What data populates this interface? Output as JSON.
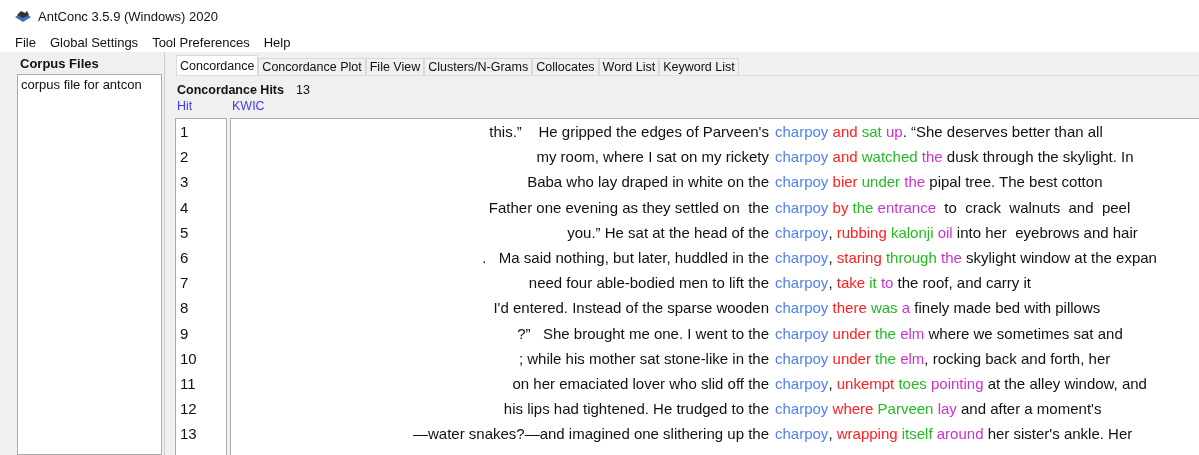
{
  "window": {
    "title": "AntConc 3.5.9 (Windows) 2020"
  },
  "menu": [
    "File",
    "Global Settings",
    "Tool Preferences",
    "Help"
  ],
  "corpus_files": {
    "heading": "Corpus Files",
    "files": [
      "corpus file for antcon"
    ]
  },
  "tabs": [
    {
      "label": "Concordance",
      "selected": true
    },
    {
      "label": "Concordance Plot",
      "selected": false
    },
    {
      "label": "File View",
      "selected": false
    },
    {
      "label": "Clusters/N-Grams",
      "selected": false
    },
    {
      "label": "Collocates",
      "selected": false
    },
    {
      "label": "Word List",
      "selected": false
    },
    {
      "label": "Keyword List",
      "selected": false
    }
  ],
  "concordance": {
    "hits_label": "Concordance Hits",
    "hits_count": "13",
    "columns": [
      "Hit",
      "KWIC"
    ],
    "rows": [
      {
        "hit": "1",
        "left": "this.”    He gripped the edges of Parveen's",
        "keyword": "charpoy",
        "words": [
          {
            "text": "and",
            "color": "#ff2020"
          },
          {
            "text": "sat",
            "color": "#22bb22"
          },
          {
            "text": "up",
            "color": "#cc33cc"
          }
        ],
        "trail": ". “She deserves better than all"
      },
      {
        "hit": "2",
        "left": "my room, where I sat on my rickety",
        "keyword": "charpoy",
        "words": [
          {
            "text": "and",
            "color": "#ff2020"
          },
          {
            "text": "watched",
            "color": "#22bb22"
          },
          {
            "text": "the",
            "color": "#cc33cc"
          }
        ],
        "trail": " dusk through the skylight. In"
      },
      {
        "hit": "3",
        "left": "Baba who lay draped in white on the",
        "keyword": "charpoy",
        "words": [
          {
            "text": "bier",
            "color": "#ff2020"
          },
          {
            "text": "under",
            "color": "#22bb22"
          },
          {
            "text": "the",
            "color": "#cc33cc"
          }
        ],
        "trail": " pipal tree. The best cotton"
      },
      {
        "hit": "4",
        "left": "Father one evening as they settled on  the",
        "keyword": "charpoy",
        "words": [
          {
            "text": "by",
            "color": "#ff2020"
          },
          {
            "text": "the",
            "color": "#22bb22"
          },
          {
            "text": "entrance",
            "color": "#cc33cc"
          }
        ],
        "trail": "  to  crack  walnuts  and  peel"
      },
      {
        "hit": "5",
        "left": "you.” He sat at the head of the",
        "keyword": "charpoy",
        "lead": ",",
        "words": [
          {
            "text": "rubbing",
            "color": "#ff2020"
          },
          {
            "text": "kalonji",
            "color": "#22bb22"
          },
          {
            "text": "oil",
            "color": "#cc33cc"
          }
        ],
        "trail": " into her  eyebrows and hair"
      },
      {
        "hit": "6",
        "left": ".   Ma said nothing, but later, huddled in the",
        "keyword": "charpoy",
        "lead": ",",
        "words": [
          {
            "text": "staring",
            "color": "#ff2020"
          },
          {
            "text": "through",
            "color": "#22bb22"
          },
          {
            "text": "the",
            "color": "#cc33cc"
          }
        ],
        "trail": " skylight window at the expan"
      },
      {
        "hit": "7",
        "left": "need four able-bodied men to lift the",
        "keyword": "charpoy",
        "lead": ",",
        "words": [
          {
            "text": "take",
            "color": "#ff2020"
          },
          {
            "text": "it",
            "color": "#22bb22"
          },
          {
            "text": "to",
            "color": "#cc33cc"
          }
        ],
        "trail": " the roof, and carry it"
      },
      {
        "hit": "8",
        "left": "I'd entered. Instead of the sparse wooden",
        "keyword": "charpoy",
        "words": [
          {
            "text": "there",
            "color": "#ff2020"
          },
          {
            "text": "was",
            "color": "#22bb22"
          },
          {
            "text": "a",
            "color": "#cc33cc"
          }
        ],
        "trail": " finely made bed with pillows"
      },
      {
        "hit": "9",
        "left": "?”   She brought me one. I went to the",
        "keyword": "charpoy",
        "words": [
          {
            "text": "under",
            "color": "#ff2020"
          },
          {
            "text": "the",
            "color": "#22bb22"
          },
          {
            "text": "elm",
            "color": "#cc33cc"
          }
        ],
        "trail": " where we sometimes sat and"
      },
      {
        "hit": "10",
        "left": "; while his mother sat stone-like in the",
        "keyword": "charpoy",
        "words": [
          {
            "text": "under",
            "color": "#ff2020"
          },
          {
            "text": "the",
            "color": "#22bb22"
          },
          {
            "text": "elm",
            "color": "#cc33cc"
          }
        ],
        "trail": ", rocking back and forth, her"
      },
      {
        "hit": "11",
        "left": "on her emaciated lover who slid off the",
        "keyword": "charpoy",
        "lead": ",",
        "words": [
          {
            "text": "unkempt",
            "color": "#ff2020"
          },
          {
            "text": "toes",
            "color": "#22bb22"
          },
          {
            "text": "pointing",
            "color": "#cc33cc"
          }
        ],
        "trail": " at the alley window, and"
      },
      {
        "hit": "12",
        "left": "his lips had tightened. He trudged to the",
        "keyword": "charpoy",
        "words": [
          {
            "text": "where",
            "color": "#ff2020"
          },
          {
            "text": "Parveen",
            "color": "#22bb22"
          },
          {
            "text": "lay",
            "color": "#cc33cc"
          }
        ],
        "trail": " and after a moment's"
      },
      {
        "hit": "13",
        "left": "—water snakes?—and imagined one slithering up the",
        "keyword": "charpoy",
        "lead": ",",
        "words": [
          {
            "text": "wrapping",
            "color": "#ff2020"
          },
          {
            "text": "itself",
            "color": "#22bb22"
          },
          {
            "text": "around",
            "color": "#cc33cc"
          }
        ],
        "trail": " her sister's ankle. Her"
      }
    ]
  }
}
